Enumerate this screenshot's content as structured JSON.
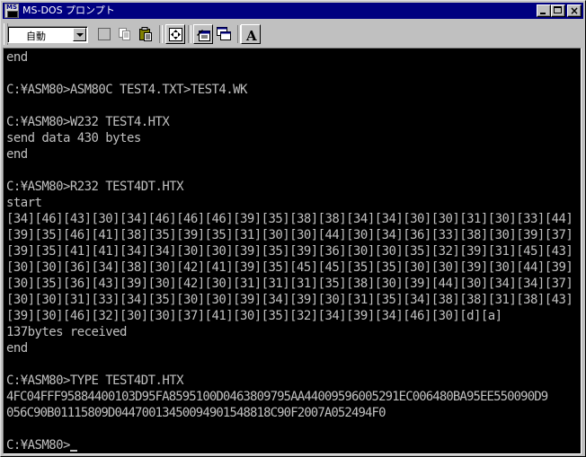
{
  "window": {
    "title": "MS-DOS プロンプト",
    "app_icon_letters": "MS",
    "close_glyph": "×"
  },
  "toolbar": {
    "font_size_value": "自動",
    "font_button_label": "A",
    "icons": [
      "mark-icon",
      "copy-icon",
      "paste-icon",
      "fullscreen-icon",
      "properties-icon",
      "background-icon",
      "font-icon"
    ]
  },
  "console": {
    "fg_color": "#c0c0c0",
    "bg_color": "#000000",
    "lines": [
      "end",
      "",
      "C:¥ASM80>ASM80C TEST4.TXT>TEST4.WK",
      "",
      "C:¥ASM80>W232 TEST4.HTX",
      "send data 430 bytes",
      "end",
      "",
      "C:¥ASM80>R232 TEST4DT.HTX",
      "start",
      "[34][46][43][30][34][46][46][46][39][35][38][38][34][34][30][30][31][30][33][44]",
      "[39][35][46][41][38][35][39][35][31][30][30][44][30][34][36][33][38][30][39][37]",
      "[39][35][41][41][34][34][30][30][39][35][39][36][30][30][35][32][39][31][45][43]",
      "[30][30][36][34][38][30][42][41][39][35][45][45][35][35][30][30][39][30][44][39]",
      "[30][35][36][43][39][30][42][30][31][31][31][35][38][30][39][44][30][34][34][37]",
      "[30][30][31][33][34][35][30][30][39][34][39][30][31][35][34][38][38][31][38][43]",
      "[39][30][46][32][30][30][37][41][30][35][32][34][39][34][46][30][d][a]",
      "137bytes received",
      "end",
      "",
      "C:¥ASM80>TYPE TEST4DT.HTX",
      "4FC04FFF95884400103D95FA8595100D0463809795AA44009596005291EC006480BA95EE550090D9",
      "056C90B01115809D04470013450094901548818C90F2007A052494F0",
      "",
      "C:¥ASM80>"
    ]
  }
}
